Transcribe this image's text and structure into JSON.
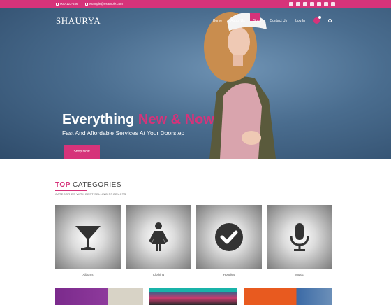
{
  "topbar": {
    "phone": "000-123-456",
    "email": "example@example.com",
    "social_icons": [
      "twitter-icon",
      "facebook-icon",
      "skype-icon",
      "instagram-icon",
      "pinterest-icon",
      "flickr-icon",
      "vimeo-icon"
    ]
  },
  "header": {
    "brand": "SHAURYA",
    "nav": [
      "Home",
      "About Us",
      "Shop",
      "Contact Us",
      "Log In"
    ]
  },
  "hero": {
    "title_main": "Everything ",
    "title_accent": "New & Now",
    "subtitle": "Fast And Affordable Services At Your Doorstep",
    "button": "Shop Now"
  },
  "categories": {
    "title_accent": "TOP",
    "title_rest": " CATEGORIES",
    "subtitle": "CATEGORIES WITH BEST SELLING PRODUCTS",
    "items": [
      {
        "label": "Albums",
        "icon": "martini-glass-icon"
      },
      {
        "label": "Clothing",
        "icon": "woman-icon"
      },
      {
        "label": "Hoodies",
        "icon": "check-circle-icon"
      },
      {
        "label": "Music",
        "icon": "microphone-icon"
      }
    ]
  },
  "colors": {
    "accent": "#d6337a",
    "hero_bg": "#4a6d8f"
  }
}
